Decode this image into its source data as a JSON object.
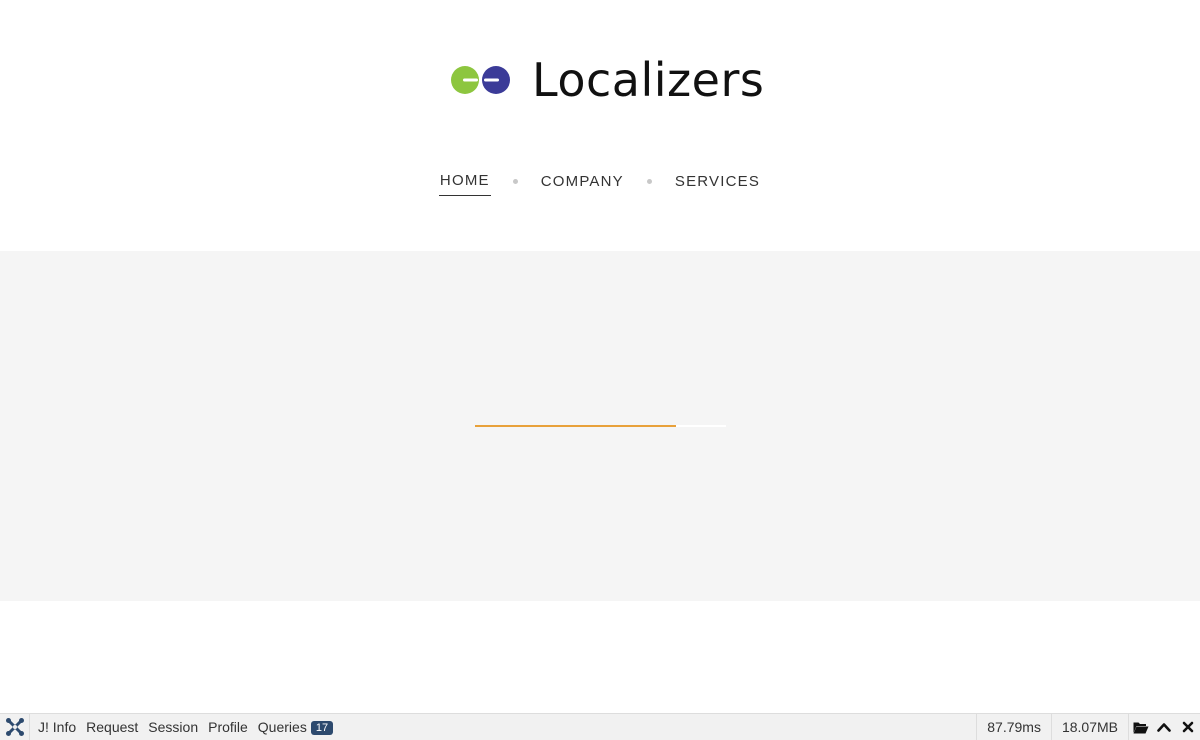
{
  "site": {
    "brand_name": "Localizers",
    "logo_colors": {
      "left": "#8dc63f",
      "right": "#3b3b98",
      "bar": "#ffffff"
    }
  },
  "nav": {
    "items": [
      {
        "label": "HOME",
        "active": true
      },
      {
        "label": "COMPANY",
        "active": false
      },
      {
        "label": "SERVICES",
        "active": false
      }
    ]
  },
  "loader": {
    "progress_percent": 80,
    "color": "#e8a13a"
  },
  "debug_toolbar": {
    "tabs": [
      {
        "label": "J! Info"
      },
      {
        "label": "Request"
      },
      {
        "label": "Session"
      },
      {
        "label": "Profile"
      },
      {
        "label": "Queries",
        "badge": "17"
      }
    ],
    "time": "87.79ms",
    "memory": "18.07MB",
    "icons": [
      "folder-open-icon",
      "chevron-up-icon",
      "close-icon"
    ]
  }
}
